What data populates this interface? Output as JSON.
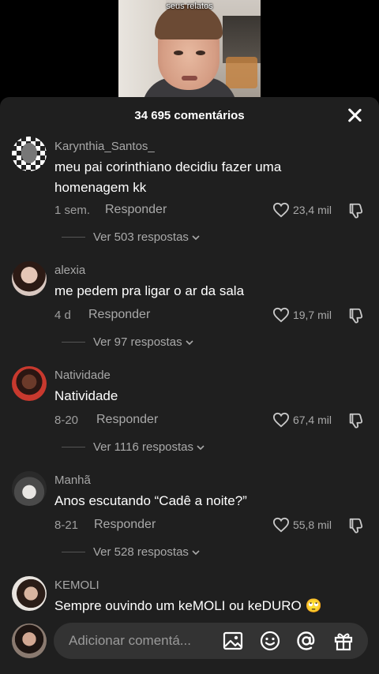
{
  "video": {
    "caption": "seus relatos"
  },
  "header": {
    "title": "34 695 comentários"
  },
  "comments": [
    {
      "user": "Karynthia_Santos_",
      "text": "meu pai corinthiano decidiu fazer uma homenagem kk",
      "time": "1 sem.",
      "reply": "Responder",
      "likes": "23,4 mil",
      "replies": "Ver 503 respostas"
    },
    {
      "user": "alexia",
      "text": "me pedem pra ligar o ar da sala",
      "time": "4 d",
      "reply": "Responder",
      "likes": "19,7 mil",
      "replies": "Ver 97 respostas"
    },
    {
      "user": "Natividade",
      "text": "Natividade",
      "time": "8-20",
      "reply": "Responder",
      "likes": "67,4 mil",
      "replies": "Ver 1116 respostas"
    },
    {
      "user": "Manhã",
      "text": "Anos escutando “Cadê a noite?”",
      "time": "8-21",
      "reply": "Responder",
      "likes": "55,8 mil",
      "replies": "Ver 528 respostas"
    },
    {
      "user": "KEMOLI",
      "text": "Sempre ouvindo um keMOLI ou keDURO",
      "emoji": "🙄"
    }
  ],
  "input": {
    "placeholder": "Adicionar comentá..."
  },
  "icons": [
    "close-icon",
    "heart-icon",
    "dislike-icon",
    "chevron-down-icon",
    "image-icon",
    "emoji-icon",
    "mention-icon",
    "gift-icon"
  ]
}
